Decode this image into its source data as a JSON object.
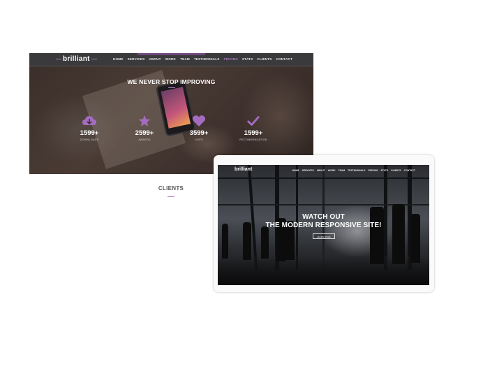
{
  "desktop_preview": {
    "logo": "brilliant",
    "nav": [
      "HOME",
      "SERVICES",
      "ABOUT",
      "WORK",
      "TEAM",
      "TESTIMONIALS",
      "PRICING",
      "STATS",
      "CLIENTS",
      "CONTACT"
    ],
    "active_nav": "PRICING",
    "headline": "WE NEVER STOP IMPROVING",
    "stats": [
      {
        "icon": "cloud-download-icon",
        "number": "1599+",
        "label": "DOWNLOADS"
      },
      {
        "icon": "star-icon",
        "number": "2599+",
        "label": "AWARDS"
      },
      {
        "icon": "heart-icon",
        "number": "3599+",
        "label": "LIKES"
      },
      {
        "icon": "checkmark-icon",
        "number": "1599+",
        "label": "RECOMMENDATION"
      }
    ],
    "section_title": "CLIENTS"
  },
  "tablet_preview": {
    "logo": "brilliant",
    "nav": [
      "HOME",
      "SERVICES",
      "ABOUT",
      "WORK",
      "TEAM",
      "TESTIMONIALS",
      "PRICING",
      "STATS",
      "CLIENTS",
      "CONTACT"
    ],
    "hero_line1": "WATCH OUT",
    "hero_line2": "THE MODERN RESPONSIVE SITE!",
    "hero_button": "LEARN MORE"
  },
  "colors": {
    "accent": "#a46cc0",
    "nav_bg": "#3a3a3c"
  }
}
